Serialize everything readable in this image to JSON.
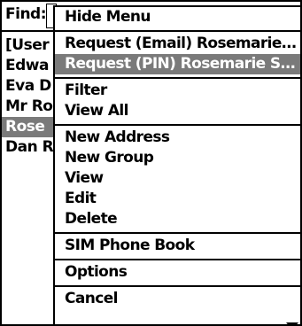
{
  "find": {
    "label": "Find:"
  },
  "contacts": [
    "[User",
    "Edwa",
    "Eva D",
    "Mr Ro",
    "Rose",
    "Dan R"
  ],
  "menu": {
    "items": [
      {
        "label": "Hide Menu"
      },
      {
        "label": "Request (Email) Rosemarie..."
      },
      {
        "label": "Request (PIN) Rosemarie Sa..."
      },
      {
        "label": "Filter"
      },
      {
        "label": "View All"
      },
      {
        "label": "New Address"
      },
      {
        "label": "New Group"
      },
      {
        "label": "View"
      },
      {
        "label": "Edit"
      },
      {
        "label": "Delete"
      },
      {
        "label": "SIM Phone Book"
      },
      {
        "label": "Options"
      },
      {
        "label": "Cancel"
      }
    ],
    "scroll_icon": "chevron-down-icon"
  }
}
